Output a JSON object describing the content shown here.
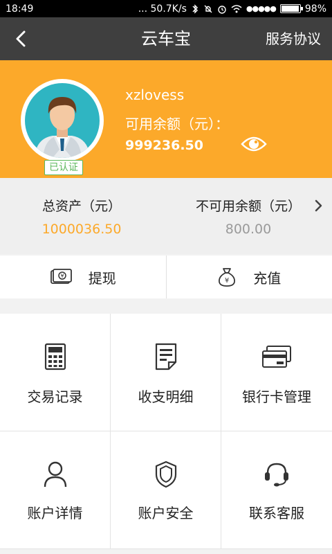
{
  "status_bar": {
    "time": "18:49",
    "net_speed": "... 50.7K/s",
    "signal": "●●●●●",
    "battery": "98%",
    "battery_level": 0.98
  },
  "navbar": {
    "title": "云车宝",
    "right_label": "服务协议"
  },
  "profile": {
    "badge": "已认证",
    "username": "xzlovess",
    "available_label": "可用余额（元）：",
    "available_value": "999236.50"
  },
  "assets": {
    "total_label": "总资产（元）",
    "total_value": "1000036.50",
    "unavailable_label": "不可用余额（元）",
    "unavailable_value": "800.00"
  },
  "actions": {
    "withdraw": "提现",
    "recharge": "充值"
  },
  "menu": {
    "items": [
      {
        "label": "交易记录",
        "icon": "calculator-icon"
      },
      {
        "label": "收支明细",
        "icon": "document-icon"
      },
      {
        "label": "银行卡管理",
        "icon": "bank-card-icon"
      },
      {
        "label": "账户详情",
        "icon": "person-icon"
      },
      {
        "label": "账户安全",
        "icon": "shield-icon"
      },
      {
        "label": "联系客服",
        "icon": "headset-icon"
      }
    ]
  },
  "colors": {
    "header_bg": "#3f3f3f",
    "profile_bg": "#fca92a",
    "total_value": "#fca92a",
    "unavailable_value": "#9a9a9a"
  }
}
